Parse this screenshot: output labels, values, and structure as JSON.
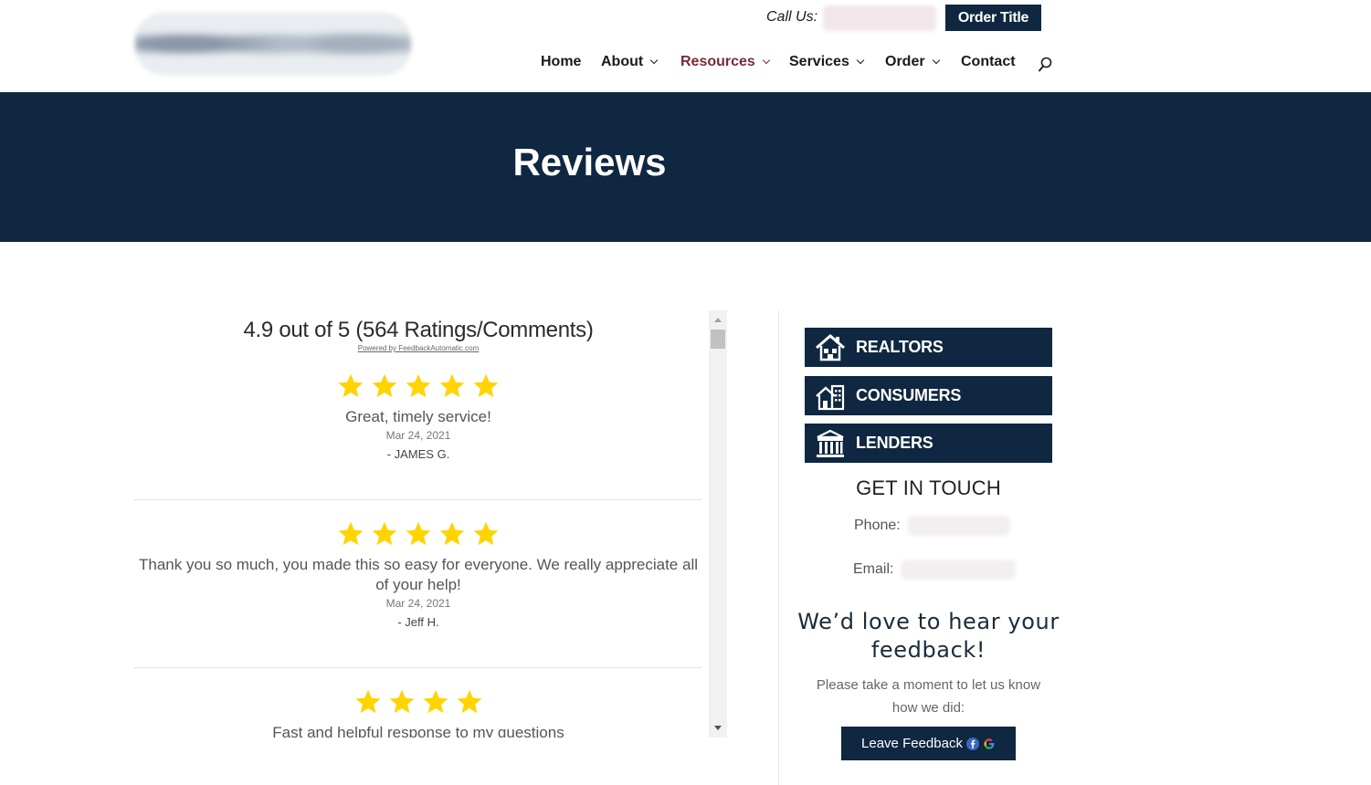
{
  "header": {
    "call_label": "Call Us:",
    "order_button": "Order Title",
    "nav": [
      {
        "label": "Home",
        "dropdown": false,
        "active": false
      },
      {
        "label": "About",
        "dropdown": true,
        "active": false
      },
      {
        "label": "Resources",
        "dropdown": true,
        "active": true
      },
      {
        "label": "Services",
        "dropdown": true,
        "active": false
      },
      {
        "label": "Order",
        "dropdown": true,
        "active": false
      },
      {
        "label": "Contact",
        "dropdown": false,
        "active": false
      }
    ],
    "search_icon": "search-icon"
  },
  "hero": {
    "title": "Reviews"
  },
  "reviews_widget": {
    "summary": "4.9 out of 5 (564 Ratings/Comments)",
    "powered_by": "Powered by FeedbackAutomatic.com",
    "reviews": [
      {
        "stars": 5,
        "text": "Great, timely service!",
        "date": "Mar 24, 2021",
        "author": "- JAMES G."
      },
      {
        "stars": 5,
        "text": "Thank you so much, you made this so easy for everyone. We really appreciate all of your help!",
        "date": "Mar 24, 2021",
        "author": "- Jeff H."
      },
      {
        "stars": 4,
        "text": "Fast and helpful response to my questions",
        "date": "",
        "author": ""
      }
    ]
  },
  "sidebar": {
    "buttons": [
      {
        "label": "REALTORS",
        "icon": "house-icon"
      },
      {
        "label": "CONSUMERS",
        "icon": "home-building-icon"
      },
      {
        "label": "LENDERS",
        "icon": "bank-icon"
      }
    ],
    "get_in_touch": "GET IN TOUCH",
    "phone_label": "Phone:",
    "email_label": "Email:",
    "feedback_title": "We’d love to hear your feedback!",
    "feedback_sub": "Please take a moment to let us know how we did:",
    "feedback_button": "Leave Feedback"
  },
  "colors": {
    "navy": "#0f2740",
    "active_nav": "#7a2a36",
    "star": "#ffd400"
  }
}
